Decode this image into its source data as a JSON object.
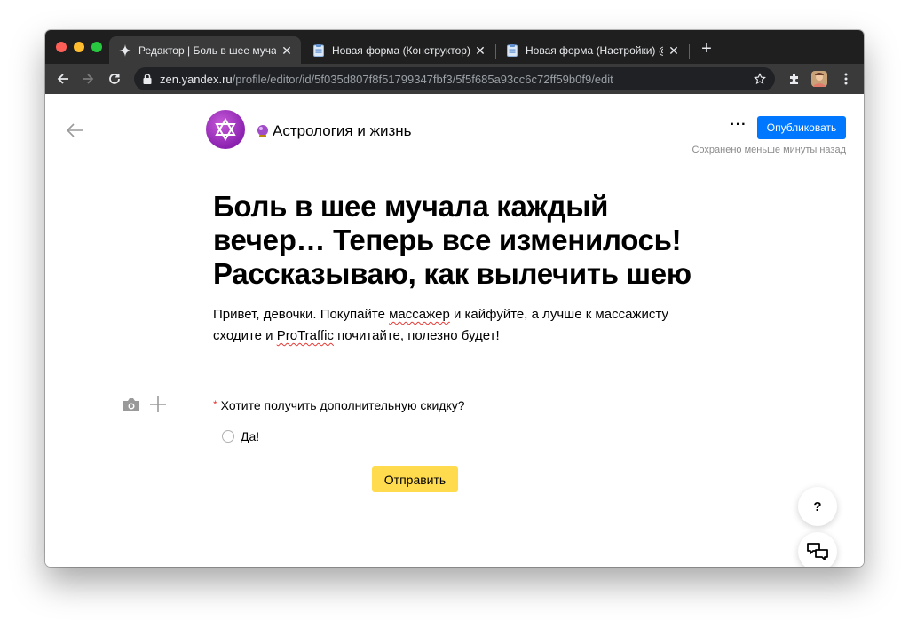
{
  "browser": {
    "tabs": [
      {
        "title": "Редактор | Боль в шее мучала",
        "active": true,
        "icon": "sparkle-icon"
      },
      {
        "title": "Новая форма (Конструктор) @",
        "active": false,
        "icon": "form-icon"
      },
      {
        "title": "Новая форма (Настройки) @",
        "active": false,
        "icon": "form-icon"
      }
    ],
    "url_host": "zen.yandex.ru",
    "url_path": "/profile/editor/id/5f035d807f8f51799347fbf3/5f5f685a93cc6c72ff59b0f9/edit"
  },
  "header": {
    "channel_name": "Астрология и жизнь",
    "more_label": "···",
    "publish_label": "Опубликовать",
    "saved_status": "Сохранено меньше минуты назад"
  },
  "article": {
    "title": "Боль в шее мучала каждый вечер… Теперь все изменилось! Рассказываю, как вылечить шею",
    "lead": {
      "part1": "Привет, девочки. Покупайте ",
      "word1": "массажер",
      "part2": " и кайфуйте, а лучше к массажисту сходите и ",
      "word2": "ProTraffic",
      "part3": " почитайте, полезно будет!"
    }
  },
  "form": {
    "required_mark": "*",
    "question": "Хотите получить дополнительную скидку?",
    "options": [
      "Да!"
    ],
    "submit_label": "Отправить"
  },
  "floating": {
    "help_label": "?"
  },
  "colors": {
    "accent_blue": "#0077ff",
    "submit_yellow": "#ffdb4d",
    "required_red": "#e53935",
    "avatar_purple": "#9b2fc2"
  }
}
